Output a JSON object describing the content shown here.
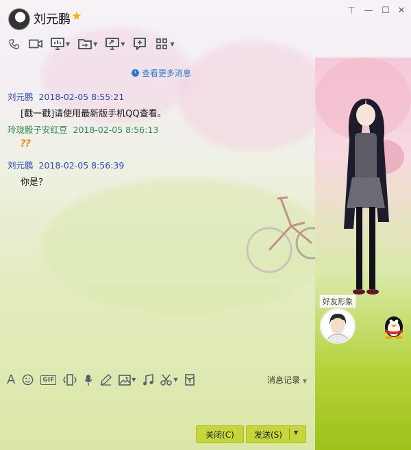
{
  "window": {
    "contact_name": "刘元鹏",
    "controls": {
      "pin": "⊤",
      "minimize": "—",
      "maximize": "☐",
      "close": "✕"
    }
  },
  "toolbar": {
    "icons": [
      "phone-icon",
      "video-icon",
      "screen-share-icon",
      "file-transfer-icon",
      "remote-desktop-icon",
      "whiteboard-icon",
      "apps-icon"
    ]
  },
  "chat": {
    "more_link": "查看更多消息",
    "messages": [
      {
        "sender": "刘元鹏",
        "time": "2018-02-05 8:55:21",
        "text": "[戳一戳]请使用最新版手机QQ查看。"
      },
      {
        "sender": "玲珑骰子安红豆",
        "time": "2018-02-05 8:56:13",
        "text": "⁇"
      },
      {
        "sender": "刘元鹏",
        "time": "2018-02-05 8:56:39",
        "text": "你是？"
      }
    ]
  },
  "input": {
    "history_label": "消息记录",
    "gif_label": "GIF"
  },
  "buttons": {
    "close_label": "关闭(C)",
    "send_label": "发送(S)"
  },
  "side": {
    "friend_label": "好友形象"
  },
  "colors": {
    "sender_self": "#2d49b8",
    "sender_other": "#2a8c4c",
    "link": "#2f7bd0",
    "button": "#c5d63a"
  }
}
